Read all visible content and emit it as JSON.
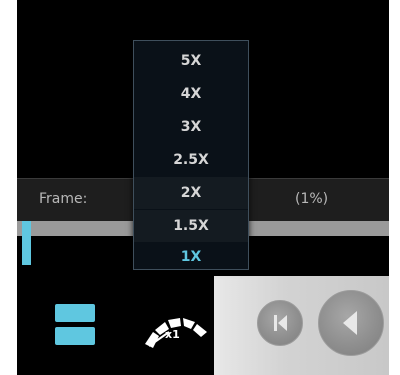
{
  "frame": {
    "label": "Frame:",
    "percent_text": "(1%)"
  },
  "progress": {
    "fraction": 0.01
  },
  "speed_menu": {
    "options": [
      "5X",
      "4X",
      "3X",
      "2.5X",
      "2X",
      "1.5X",
      "1X"
    ],
    "selected": "1X"
  },
  "controls": {
    "speed_indicator": "x1",
    "icons": [
      "layout-icon",
      "speed-gauge-icon",
      "step-back-icon",
      "previous-icon"
    ]
  },
  "colors": {
    "accent": "#5fc7e0",
    "background": "#000000",
    "track": "#9a9a9a"
  }
}
